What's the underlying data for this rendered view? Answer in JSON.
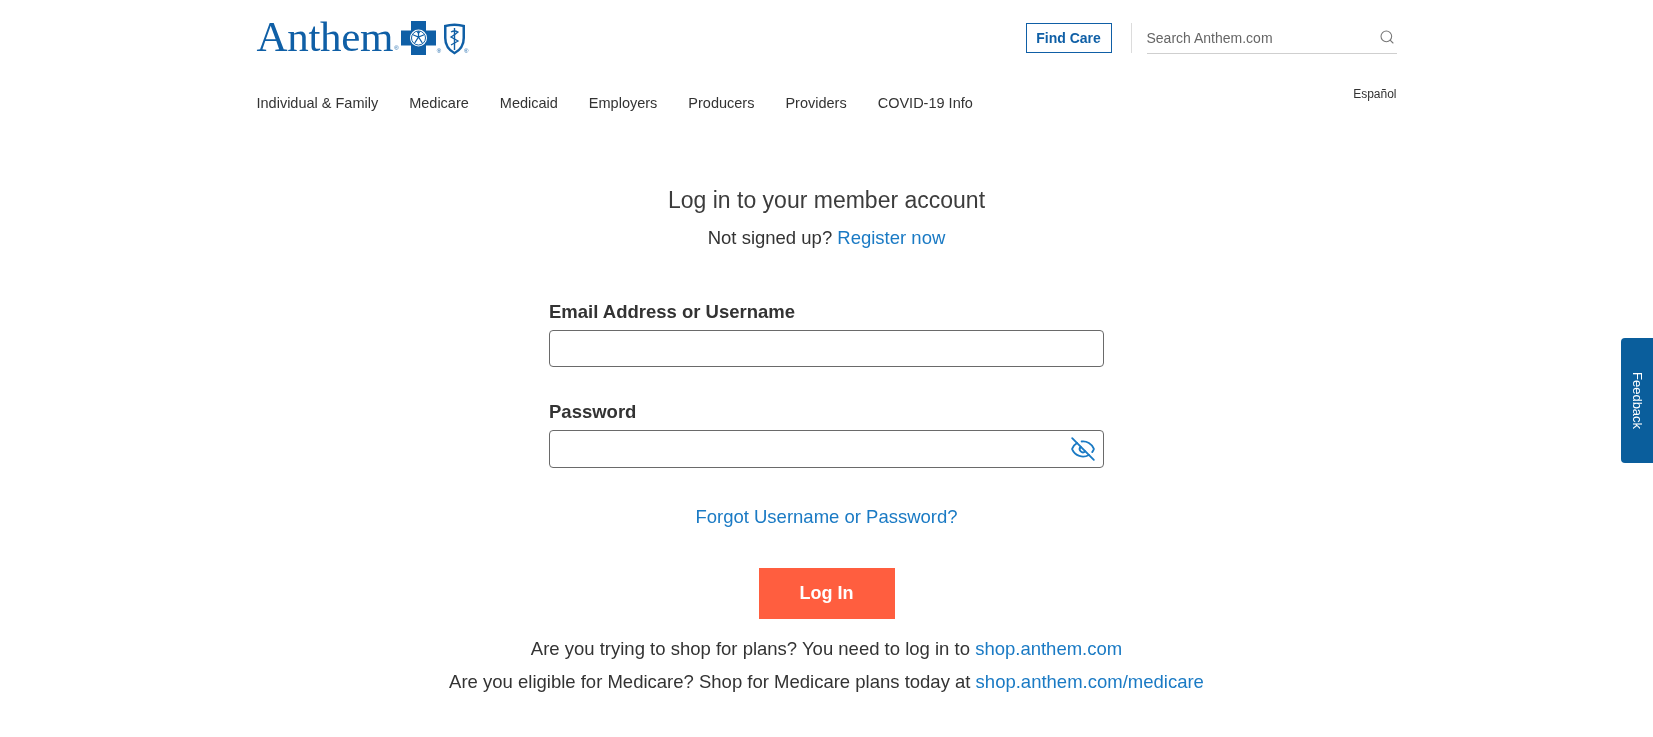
{
  "header": {
    "logo": {
      "wordmark": "Anthem",
      "registered_marks": [
        "®",
        "®",
        "®"
      ]
    },
    "find_care_button": "Find Care",
    "search": {
      "placeholder": "Search Anthem.com"
    },
    "language_link": "Español"
  },
  "nav": {
    "items": [
      "Individual & Family",
      "Medicare",
      "Medicaid",
      "Employers",
      "Producers",
      "Providers",
      "COVID-19 Info"
    ]
  },
  "login": {
    "title": "Log in to your member account",
    "signup_prompt": "Not signed up?",
    "register_link": "Register now",
    "fields": [
      {
        "kind": "text",
        "label": "Email Address or Username"
      },
      {
        "kind": "password",
        "label": "Password"
      }
    ],
    "forgot_link": "Forgot Username or Password?",
    "submit_button": "Log In",
    "notes": [
      {
        "text": "Are you trying to shop for plans? You need to log in to",
        "link": "shop.anthem.com"
      },
      {
        "text": "Are you eligible for Medicare? Shop for Medicare plans today at",
        "link": "shop.anthem.com/medicare"
      }
    ]
  },
  "feedback_tab": "Feedback"
}
